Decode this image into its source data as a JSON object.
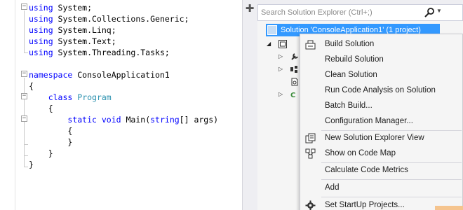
{
  "editor": {
    "lines": [
      {
        "parts": [
          {
            "t": "using",
            "c": "kw"
          },
          {
            "t": " System;",
            "c": ""
          }
        ]
      },
      {
        "parts": [
          {
            "t": "using",
            "c": "kw"
          },
          {
            "t": " System.Collections.Generic;",
            "c": ""
          }
        ]
      },
      {
        "parts": [
          {
            "t": "using",
            "c": "kw"
          },
          {
            "t": " System.Linq;",
            "c": ""
          }
        ]
      },
      {
        "parts": [
          {
            "t": "using",
            "c": "kw"
          },
          {
            "t": " System.Text;",
            "c": ""
          }
        ]
      },
      {
        "parts": [
          {
            "t": "using",
            "c": "kw"
          },
          {
            "t": " System.Threading.Tasks;",
            "c": ""
          }
        ]
      },
      {
        "parts": [
          {
            "t": "",
            "c": ""
          }
        ]
      },
      {
        "parts": [
          {
            "t": "namespace",
            "c": "kw"
          },
          {
            "t": " ConsoleApplication1",
            "c": ""
          }
        ]
      },
      {
        "parts": [
          {
            "t": "{",
            "c": ""
          }
        ]
      },
      {
        "parts": [
          {
            "t": "    ",
            "c": ""
          },
          {
            "t": "class",
            "c": "kw"
          },
          {
            "t": " ",
            "c": ""
          },
          {
            "t": "Program",
            "c": "cls"
          }
        ]
      },
      {
        "parts": [
          {
            "t": "    {",
            "c": ""
          }
        ]
      },
      {
        "parts": [
          {
            "t": "        ",
            "c": ""
          },
          {
            "t": "static",
            "c": "kw"
          },
          {
            "t": " ",
            "c": ""
          },
          {
            "t": "void",
            "c": "kw"
          },
          {
            "t": " Main(",
            "c": ""
          },
          {
            "t": "string",
            "c": "kw"
          },
          {
            "t": "[] args)",
            "c": ""
          }
        ]
      },
      {
        "parts": [
          {
            "t": "        {",
            "c": ""
          }
        ]
      },
      {
        "parts": [
          {
            "t": "        }",
            "c": ""
          }
        ]
      },
      {
        "parts": [
          {
            "t": "    }",
            "c": ""
          }
        ]
      },
      {
        "parts": [
          {
            "t": "}",
            "c": ""
          }
        ]
      }
    ]
  },
  "explorer": {
    "search_placeholder": "Search Solution Explorer (Ctrl+;)",
    "solution_label": "Solution 'ConsoleApplication1' (1 project)"
  },
  "context_menu": {
    "items": [
      {
        "label": "Build Solution",
        "icon": "build-icon"
      },
      {
        "label": "Rebuild Solution",
        "icon": ""
      },
      {
        "label": "Clean Solution",
        "icon": ""
      },
      {
        "label": "Run Code Analysis on Solution",
        "icon": ""
      },
      {
        "label": "Batch Build...",
        "icon": ""
      },
      {
        "label": "Configuration Manager...",
        "icon": ""
      },
      {
        "label": "New Solution Explorer View",
        "icon": "new-view-icon"
      },
      {
        "label": "Show on Code Map",
        "icon": "code-map-icon"
      },
      {
        "label": "Calculate Code Metrics",
        "icon": ""
      },
      {
        "label": "Add",
        "icon": ""
      },
      {
        "label": "Set StartUp Projects...",
        "icon": "gear-icon"
      }
    ]
  },
  "colors": {
    "keyword": "#0000ff",
    "type": "#2b91af",
    "selection": "#3399ff"
  }
}
